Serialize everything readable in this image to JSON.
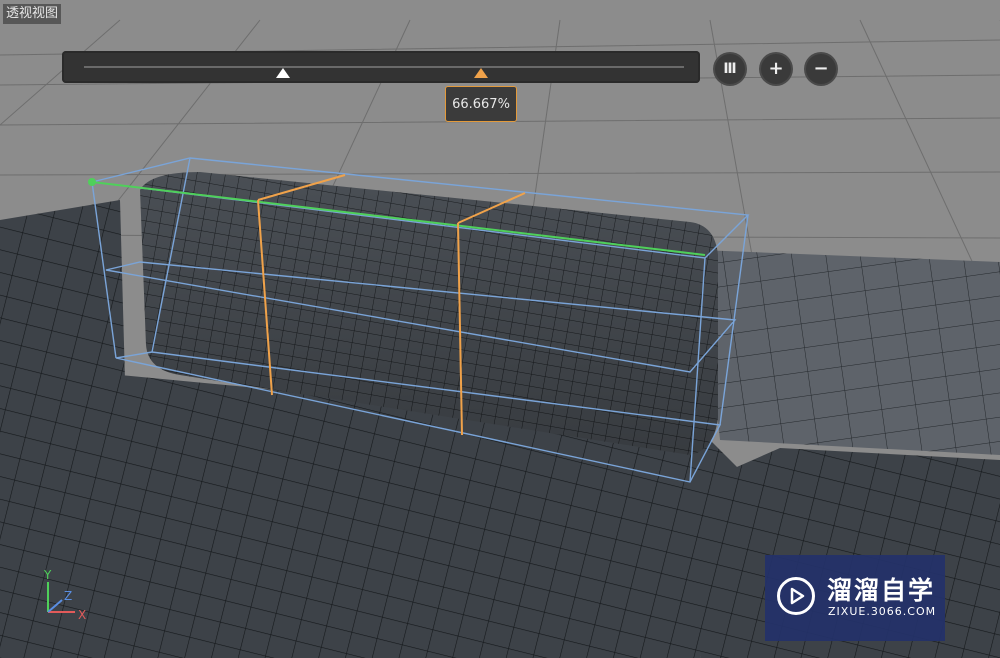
{
  "viewport": {
    "label": "透视视图"
  },
  "loop_cut": {
    "value_label": "66.667%",
    "handle_position": 0.667,
    "accent_color": "#f0a24a"
  },
  "controls": {
    "pause": {
      "icon": "pause-icon",
      "glyph": "Ⅲ"
    },
    "add": {
      "icon": "plus-icon",
      "glyph": "+"
    },
    "remove": {
      "icon": "minus-icon",
      "glyph": "−"
    }
  },
  "axes": {
    "y": "Y",
    "z": "Z",
    "x": "X"
  },
  "watermark": {
    "title": "溜溜自学",
    "subtitle": "ZIXUE.3066.COM"
  }
}
